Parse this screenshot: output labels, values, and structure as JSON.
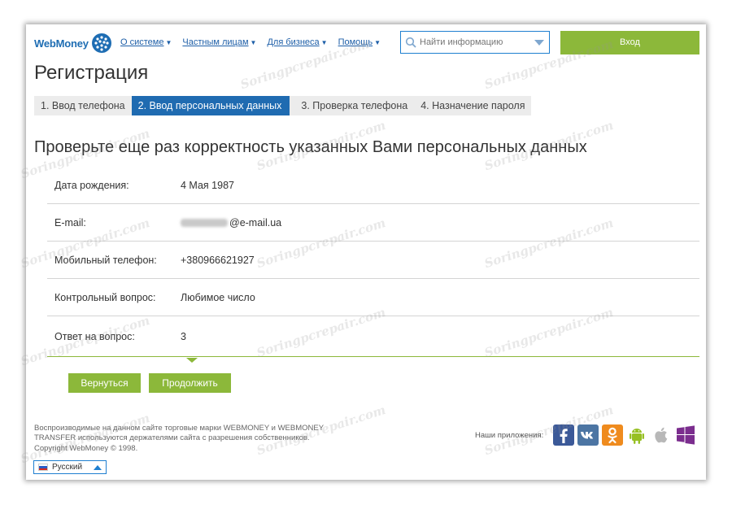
{
  "header": {
    "logo_text": "WebMoney",
    "nav": [
      {
        "label": "О системе"
      },
      {
        "label": "Частным лицам"
      },
      {
        "label": "Для бизнеса"
      },
      {
        "label": "Помощь"
      }
    ],
    "search_placeholder": "Найти информацию",
    "login_label": "Вход"
  },
  "page": {
    "title": "Регистрация",
    "steps": [
      {
        "label": "1. Ввод телефона",
        "active": false
      },
      {
        "label": "2. Ввод персональных данных",
        "active": true
      },
      {
        "label": "3. Проверка телефона",
        "active": false
      },
      {
        "label": "4. Назначение пароля",
        "active": false
      }
    ],
    "check_heading": "Проверьте еще раз корректность указанных Вами персональных данных",
    "rows": [
      {
        "label": "Дата рождения:",
        "value": "4 Мая 1987"
      },
      {
        "label": "E-mail:",
        "value": "@e-mail.ua"
      },
      {
        "label": "Мобильный телефон:",
        "value": "+380966621927"
      },
      {
        "label": "Контрольный вопрос:",
        "value": "Любимое число"
      },
      {
        "label": "Ответ на вопрос:",
        "value": "3"
      }
    ],
    "back_label": "Вернуться",
    "continue_label": "Продолжить"
  },
  "footer": {
    "trademark": "Воспроизводимые на данном сайте торговые марки WEBMONEY и WEBMONEY TRANSFER используются держателями сайта с разрешения собственников.",
    "copyright": "Copyright WebMoney © 1998.",
    "language": "Русский",
    "apps_label": "Наши приложения:",
    "apps": [
      "facebook-icon",
      "vk-icon",
      "odnoklassniki-icon",
      "android-icon",
      "apple-icon",
      "windows-icon"
    ]
  },
  "watermark": "Soringpcrepair.com",
  "colors": {
    "accent_green": "#8cb83a",
    "accent_blue": "#1f6bb1",
    "link_blue": "#1e5fa8"
  }
}
